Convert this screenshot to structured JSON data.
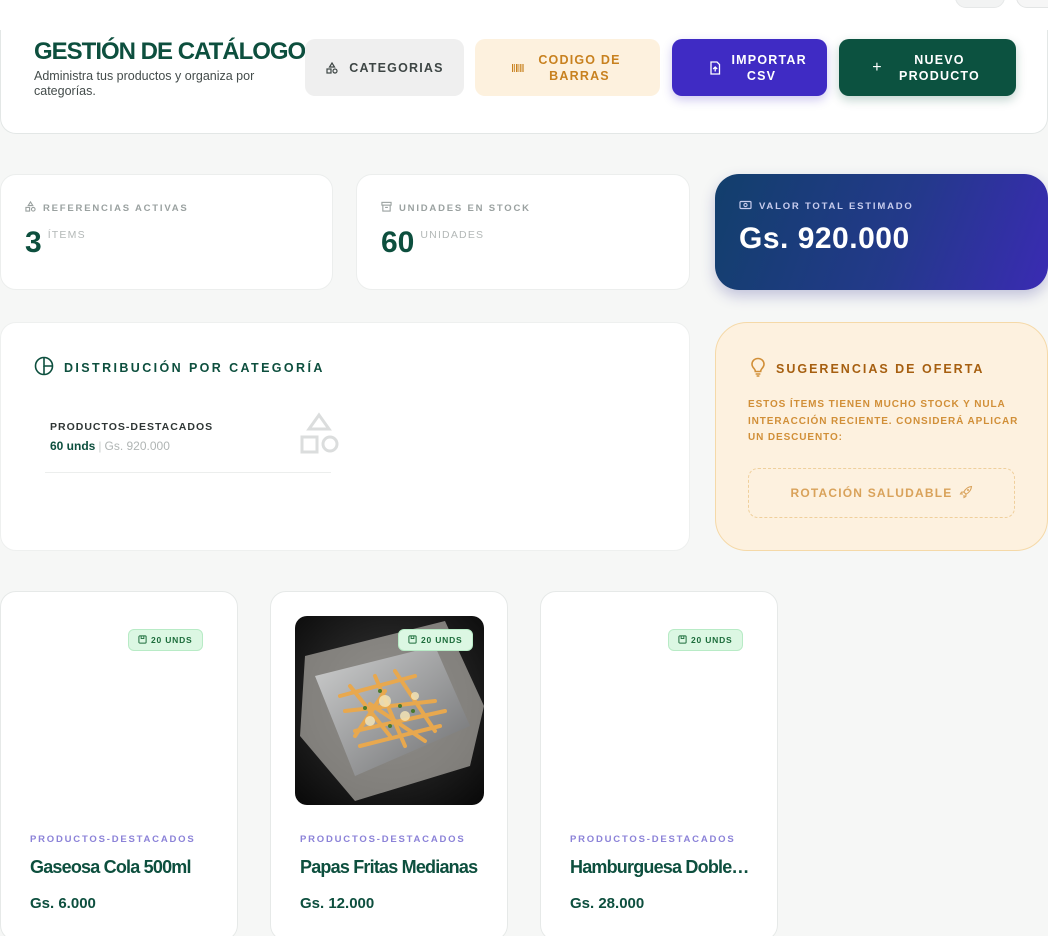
{
  "header": {
    "title": "GESTIÓN DE CATÁLOGO",
    "subtitle": "Administra tus productos y organiza por categorías.",
    "buttons": {
      "categories": "CATEGORIAS",
      "barcode": "CODIGO DE BARRAS",
      "import_csv": "IMPORTAR CSV",
      "new_product": "NUEVO PRODUCTO"
    }
  },
  "stats": {
    "active_refs": {
      "label": "REFERENCIAS ACTIVAS",
      "value": "3",
      "unit": "ÍTEMS"
    },
    "stock_units": {
      "label": "UNIDADES EN STOCK",
      "value": "60",
      "unit": "UNIDADES"
    },
    "total_value": {
      "label": "VALOR TOTAL ESTIMADO",
      "value": "Gs. 920.000"
    }
  },
  "distribution": {
    "title": "DISTRIBUCIÓN POR CATEGORÍA",
    "items": [
      {
        "category": "PRODUCTOS-DESTACADOS",
        "units": "60 unds",
        "separator": "|",
        "value": "Gs. 920.000"
      }
    ]
  },
  "suggestions": {
    "title": "SUGERENCIAS DE OFERTA",
    "text": "ESTOS ÍTEMS TIENEN MUCHO STOCK Y NULA INTERACCIÓN RECIENTE. CONSIDERÁ APLICAR UN DESCUENTO:",
    "status": "ROTACIÓN SALUDABLE"
  },
  "products": [
    {
      "badge": "20 UNDS",
      "category": "PRODUCTOS-DESTACADOS",
      "name": "Gaseosa Cola 500ml",
      "price": "Gs. 6.000"
    },
    {
      "badge": "20 UNDS",
      "category": "PRODUCTOS-DESTACADOS",
      "name": "Papas Fritas Medianas",
      "price": "Gs. 12.000"
    },
    {
      "badge": "20 UNDS",
      "category": "PRODUCTOS-DESTACADOS",
      "name": "Hamburguesa Doble…",
      "price": "Gs. 28.000"
    }
  ],
  "colors": {
    "brand_green": "#0d4f3e",
    "accent_purple": "#3f2bc4",
    "barcode_orange": "#c8811f",
    "suggestion_bg": "#fdf1df"
  },
  "icons": {
    "categories": "shapes-icon",
    "barcode": "barcode-icon",
    "import": "file-upload-icon",
    "new": "plus-icon",
    "stock": "archive-icon",
    "value": "banknote-icon",
    "distribution": "pie-chart-icon",
    "suggestion": "lightbulb-icon",
    "rocket": "rocket-icon",
    "badge": "box-icon"
  }
}
